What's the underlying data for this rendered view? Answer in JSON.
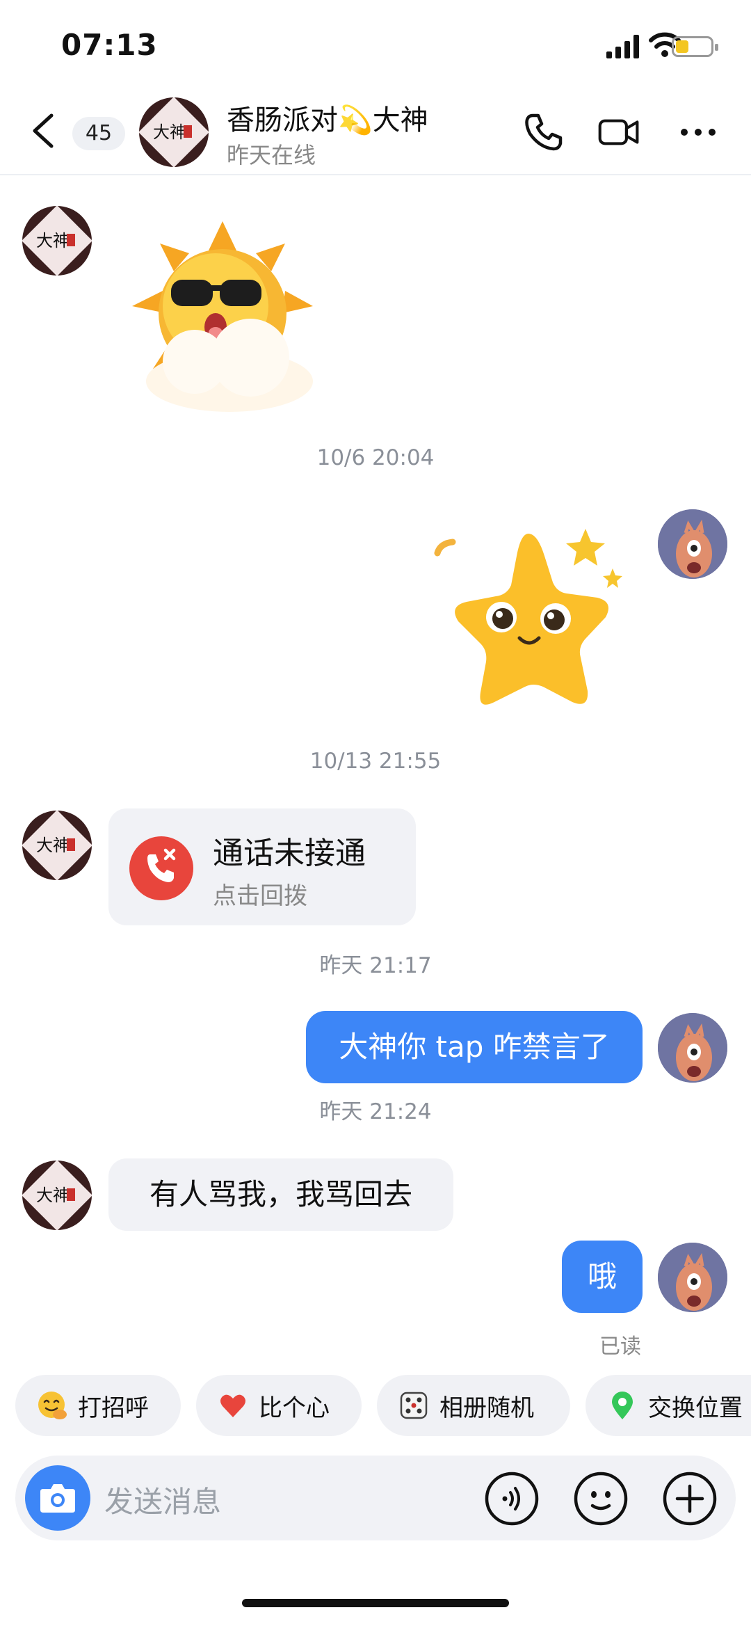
{
  "status_bar": {
    "time": "07:13",
    "battery_level": 0.34
  },
  "header": {
    "unread_count": "45",
    "contact_name": "香肠派对💫大神",
    "contact_status": "昨天在线",
    "avatar_text": "大神"
  },
  "messages": {
    "ts1": "10/6 20:04",
    "ts2": "10/13 21:55",
    "missed_call_title": "通话未接通",
    "missed_call_action": "点击回拨",
    "ts3": "昨天 21:17",
    "msg_out_1": "大神你 tap 咋禁言了",
    "ts4": "昨天 21:24",
    "msg_in_1": "有人骂我，我骂回去",
    "msg_out_2": "哦",
    "read_receipt": "已读"
  },
  "quick_actions": [
    "打招呼",
    "比个心",
    "相册随机",
    "交换位置"
  ],
  "input": {
    "placeholder": "发送消息"
  },
  "colors": {
    "accent": "#3d86f7",
    "bubble_in": "#f1f2f6",
    "missed_call": "#e8453c"
  }
}
